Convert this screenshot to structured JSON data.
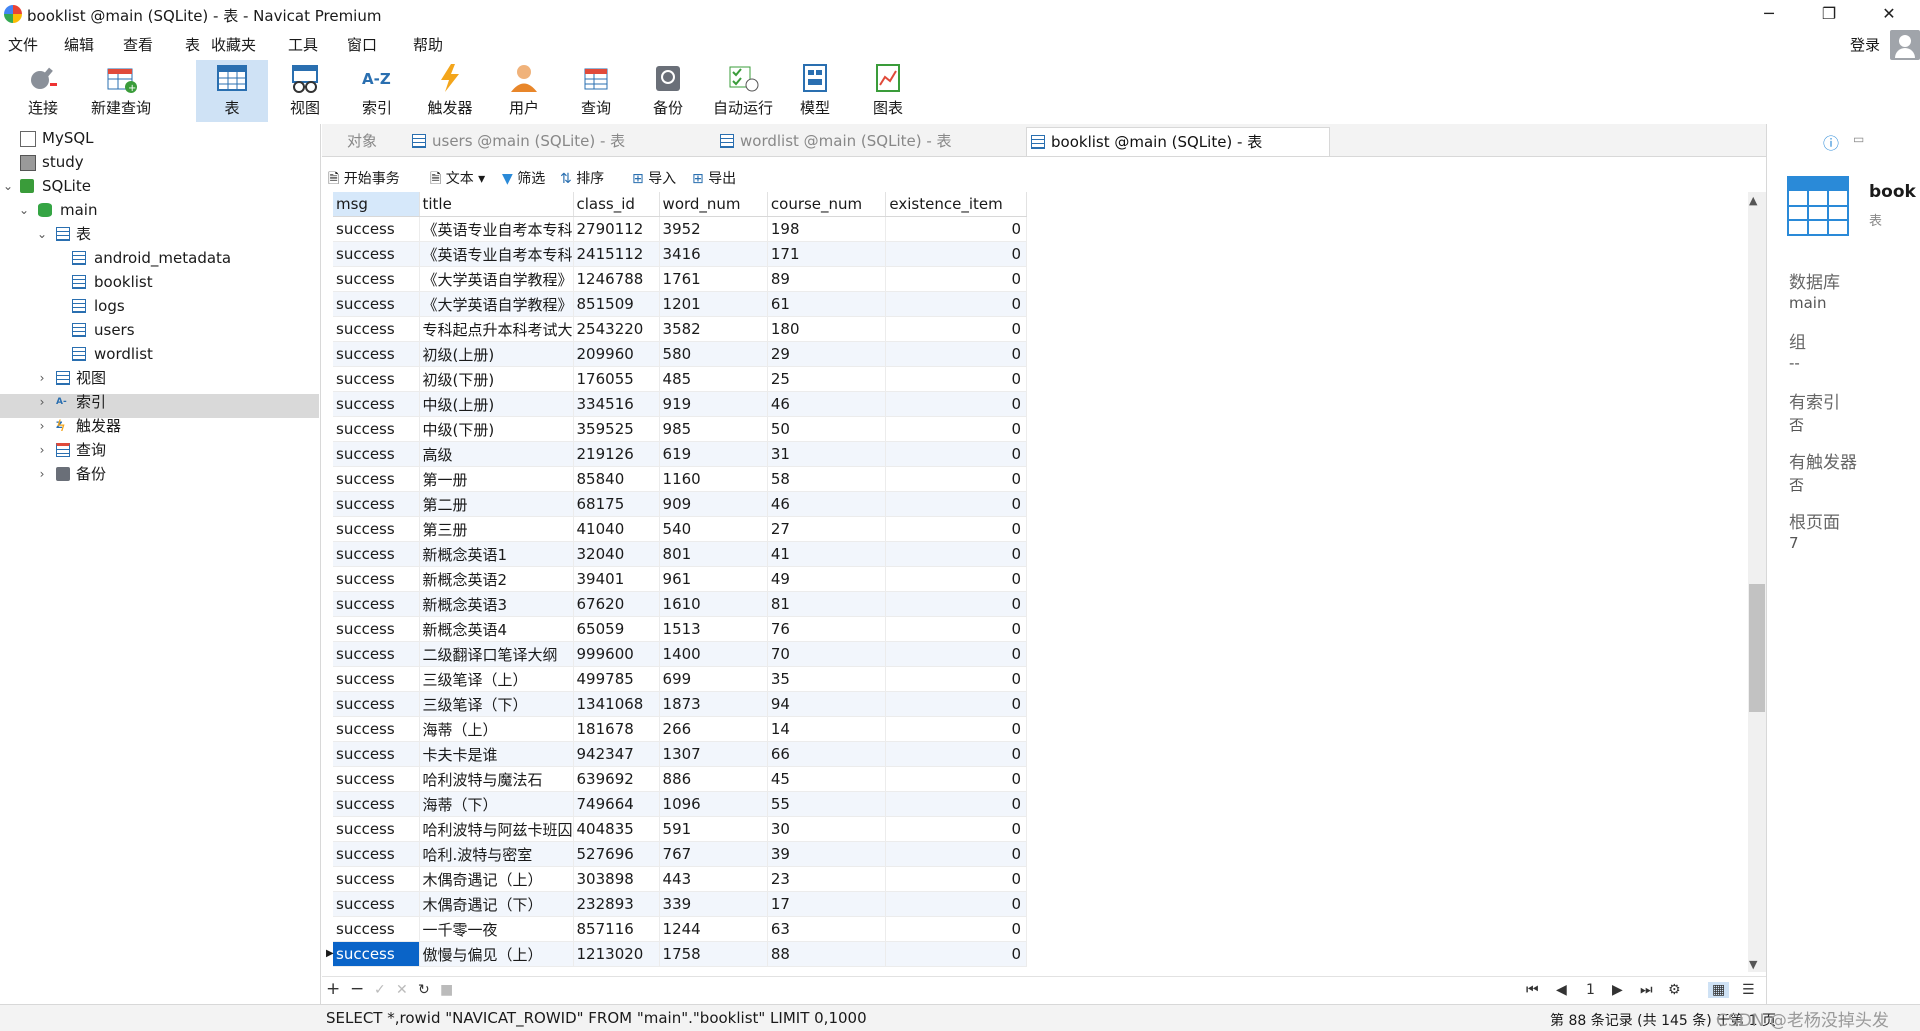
{
  "window": {
    "title": "booklist @main (SQLite) - 表 - Navicat Premium",
    "minimize": "─",
    "maximize": "❐",
    "close": "✕"
  },
  "menu": [
    "文件",
    "编辑",
    "查看",
    "表",
    "收藏夹",
    "工具",
    "窗口",
    "帮助"
  ],
  "login": "登录",
  "toolbar": [
    {
      "label": "连接",
      "icon": "plug-icon"
    },
    {
      "label": "新建查询",
      "icon": "new-query-icon"
    },
    {
      "label": "表",
      "icon": "table-icon"
    },
    {
      "label": "视图",
      "icon": "view-icon"
    },
    {
      "label": "索引",
      "icon": "index-icon"
    },
    {
      "label": "触发器",
      "icon": "trigger-icon"
    },
    {
      "label": "用户",
      "icon": "user-icon"
    },
    {
      "label": "查询",
      "icon": "query-icon"
    },
    {
      "label": "备份",
      "icon": "backup-icon"
    },
    {
      "label": "自动运行",
      "icon": "automation-icon"
    },
    {
      "label": "模型",
      "icon": "model-icon"
    },
    {
      "label": "图表",
      "icon": "chart-icon"
    }
  ],
  "sidebar": {
    "connections": [
      "MySQL",
      "study",
      "SQLite"
    ],
    "database": "main",
    "tables_group": "表",
    "tables": [
      "android_metadata",
      "booklist",
      "logs",
      "users",
      "wordlist"
    ],
    "groups": [
      "视图",
      "索引",
      "触发器",
      "查询",
      "备份"
    ]
  },
  "tabs": {
    "objects": "对象",
    "items": [
      "users @main (SQLite) - 表",
      "wordlist @main (SQLite) - 表",
      "booklist @main (SQLite) - 表"
    ]
  },
  "objbar": {
    "begin": "开始事务",
    "text": "文本",
    "filter": "筛选",
    "sort": "排序",
    "import": "导入",
    "export": "导出"
  },
  "grid": {
    "columns": [
      "msg",
      "title",
      "class_id",
      "word_num",
      "course_num",
      "existence_item"
    ],
    "rows": [
      [
        "success",
        "《英语专业自考本专科",
        "2790112",
        "3952",
        "198",
        "0"
      ],
      [
        "success",
        "《英语专业自考本专科",
        "2415112",
        "3416",
        "171",
        "0"
      ],
      [
        "success",
        "《大学英语自学教程》",
        "1246788",
        "1761",
        "89",
        "0"
      ],
      [
        "success",
        "《大学英语自学教程》",
        "851509",
        "1201",
        "61",
        "0"
      ],
      [
        "success",
        "专科起点升本科考试大",
        "2543220",
        "3582",
        "180",
        "0"
      ],
      [
        "success",
        "初级(上册)",
        "209960",
        "580",
        "29",
        "0"
      ],
      [
        "success",
        "初级(下册)",
        "176055",
        "485",
        "25",
        "0"
      ],
      [
        "success",
        "中级(上册)",
        "334516",
        "919",
        "46",
        "0"
      ],
      [
        "success",
        "中级(下册)",
        "359525",
        "985",
        "50",
        "0"
      ],
      [
        "success",
        "高级",
        "219126",
        "619",
        "31",
        "0"
      ],
      [
        "success",
        "第一册",
        "85840",
        "1160",
        "58",
        "0"
      ],
      [
        "success",
        "第二册",
        "68175",
        "909",
        "46",
        "0"
      ],
      [
        "success",
        "第三册",
        "41040",
        "540",
        "27",
        "0"
      ],
      [
        "success",
        "新概念英语1",
        "32040",
        "801",
        "41",
        "0"
      ],
      [
        "success",
        "新概念英语2",
        "39401",
        "961",
        "49",
        "0"
      ],
      [
        "success",
        "新概念英语3",
        "67620",
        "1610",
        "81",
        "0"
      ],
      [
        "success",
        "新概念英语4",
        "65059",
        "1513",
        "76",
        "0"
      ],
      [
        "success",
        "二级翻译口笔译大纲",
        "999600",
        "1400",
        "70",
        "0"
      ],
      [
        "success",
        "三级笔译（上）",
        "499785",
        "699",
        "35",
        "0"
      ],
      [
        "success",
        "三级笔译（下）",
        "1341068",
        "1873",
        "94",
        "0"
      ],
      [
        "success",
        "海蒂（上）",
        "181678",
        "266",
        "14",
        "0"
      ],
      [
        "success",
        "卡夫卡是谁",
        "942347",
        "1307",
        "66",
        "0"
      ],
      [
        "success",
        "哈利波特与魔法石",
        "639692",
        "886",
        "45",
        "0"
      ],
      [
        "success",
        "海蒂（下）",
        "749664",
        "1096",
        "55",
        "0"
      ],
      [
        "success",
        "哈利波特与阿兹卡班囚",
        "404835",
        "591",
        "30",
        "0"
      ],
      [
        "success",
        "哈利.波特与密室",
        "527696",
        "767",
        "39",
        "0"
      ],
      [
        "success",
        "木偶奇遇记（上）",
        "303898",
        "443",
        "23",
        "0"
      ],
      [
        "success",
        "木偶奇遇记（下）",
        "232893",
        "339",
        "17",
        "0"
      ],
      [
        "success",
        "一千零一夜",
        "857116",
        "1244",
        "63",
        "0"
      ],
      [
        "success",
        "傲慢与偏见（上）",
        "1213020",
        "1758",
        "88",
        "0"
      ]
    ]
  },
  "nav": {
    "page": "1"
  },
  "status": {
    "sql": "SELECT *,rowid \"NAVICAT_ROWID\" FROM \"main\".\"booklist\" LIMIT 0,1000",
    "records": "第 88 条记录 (共 145 条) 于第 1 页",
    "watermark": "CSDN @老杨没掉头发"
  },
  "info": {
    "name": "book",
    "type": "表",
    "fields": [
      {
        "label": "数据库",
        "value": "main"
      },
      {
        "label": "组",
        "value": "--"
      },
      {
        "label": "有索引",
        "value": "否"
      },
      {
        "label": "有触发器",
        "value": "否"
      },
      {
        "label": "根页面",
        "value": "7"
      }
    ]
  }
}
